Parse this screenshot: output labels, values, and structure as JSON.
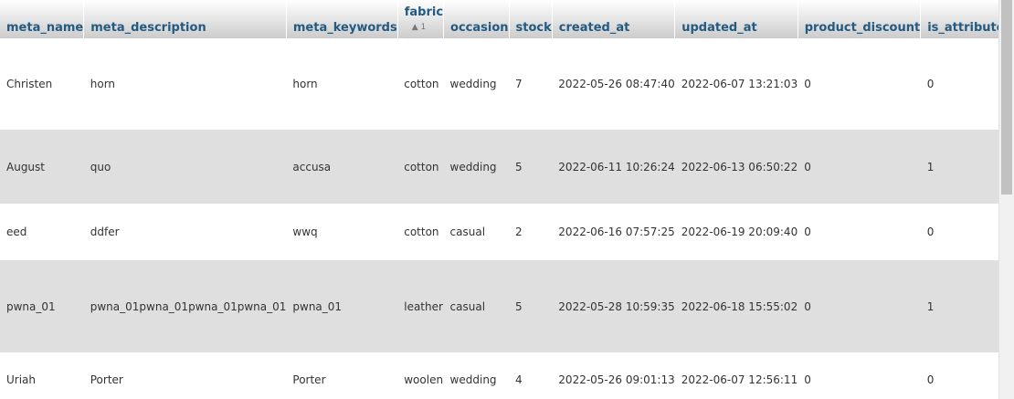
{
  "table": {
    "columns": [
      {
        "key": "meta_name",
        "label": "meta_name"
      },
      {
        "key": "meta_description",
        "label": "meta_description"
      },
      {
        "key": "meta_keywords",
        "label": "meta_keywords"
      },
      {
        "key": "fabric",
        "label": "fabric",
        "sort_indicator": "▲ 1"
      },
      {
        "key": "occasion",
        "label": "occasion"
      },
      {
        "key": "stock",
        "label": "stock"
      },
      {
        "key": "created_at",
        "label": "created_at"
      },
      {
        "key": "updated_at",
        "label": "updated_at"
      },
      {
        "key": "product_discount",
        "label": "product_discount"
      },
      {
        "key": "is_attribute",
        "label": "is_attribute"
      }
    ],
    "rows": [
      [
        "Christen",
        "horn",
        "horn",
        "cotton",
        "wedding",
        "7",
        "2022-05-26 08:47:40",
        "2022-06-07 13:21:03",
        "0",
        "0"
      ],
      [
        "August",
        "quo",
        "accusa",
        "cotton",
        "wedding",
        "5",
        "2022-06-11 10:26:24",
        "2022-06-13 06:50:22",
        "0",
        "1"
      ],
      [
        "eed",
        "ddfer",
        "wwq",
        "cotton",
        "casual",
        "2",
        "2022-06-16 07:57:25",
        "2022-06-19 20:09:40",
        "0",
        "0"
      ],
      [
        "pwna_01",
        "pwna_01pwna_01pwna_01pwna_01",
        "pwna_01",
        "leather",
        "casual",
        "5",
        "2022-05-28 10:59:35",
        "2022-06-18 15:55:02",
        "0",
        "1"
      ],
      [
        "Uriah",
        "Porter",
        "Porter",
        "woolen",
        "wedding",
        "4",
        "2022-05-26 09:01:13",
        "2022-06-07 12:56:11",
        "0",
        "0"
      ]
    ]
  },
  "colors": {
    "header_link": "#235a81",
    "row_even_bg": "#dfdfdf",
    "row_odd_bg": "#ffffff"
  }
}
